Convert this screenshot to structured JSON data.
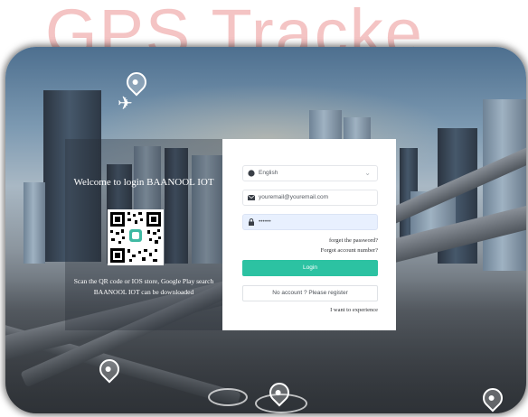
{
  "watermark": {
    "text": "GPS Tracke"
  },
  "welcome": {
    "title": "Welcome to login BAANOOL IOT",
    "scan_line1": "Scan the QR code or IOS store, Google Play search",
    "scan_line2": "BAANOOL IOT can be downloaded"
  },
  "login": {
    "language": "English",
    "email_placeholder": "youremail@youremail.com",
    "password_mask": "••••••",
    "forgot_password": "forget the password?",
    "forgot_account": "Forgot account number?",
    "login_label": "Login",
    "register_label": "No account ? Please register",
    "experience_label": "I want to experience"
  },
  "icons": [
    "globe-icon",
    "envelope-icon",
    "lock-icon",
    "chevron-down-icon",
    "location-pin-icon",
    "airplane-icon",
    "qr-code-icon"
  ],
  "colors": {
    "login_button": "#2cc2a2",
    "watermark": "#f4c4c4",
    "password_fill": "#e8f0fe"
  }
}
